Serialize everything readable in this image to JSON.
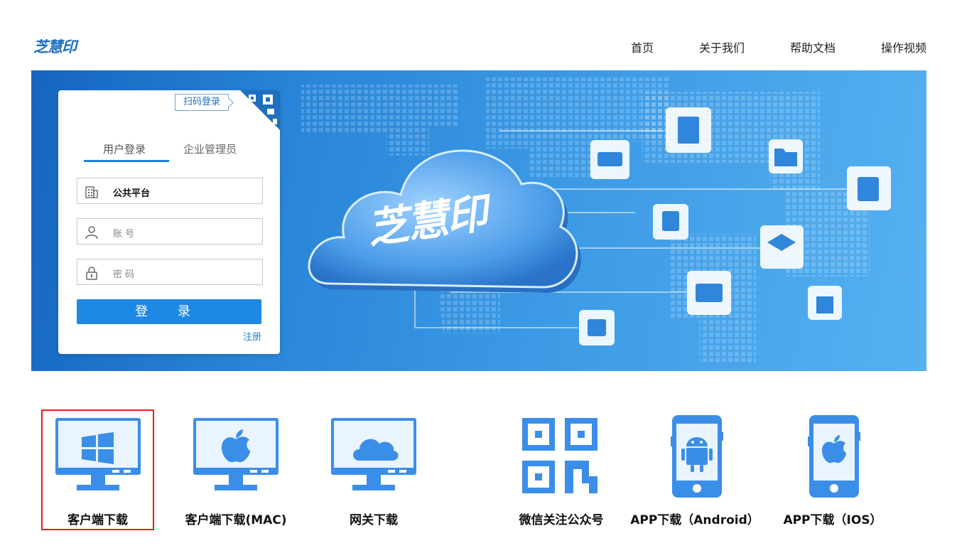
{
  "header": {
    "logo": "芝慧印",
    "nav": [
      "首页",
      "关于我们",
      "帮助文档",
      "操作视频"
    ]
  },
  "login": {
    "qr_login_label": "扫码登录",
    "tabs": [
      "用户登录",
      "企业管理员"
    ],
    "active_tab": 0,
    "platform_value": "公共平台",
    "account_placeholder": "账号",
    "password_placeholder": "密码",
    "login_button": "登 录",
    "register_link": "注册"
  },
  "banner": {
    "cloud_logo_text": "芝慧印"
  },
  "downloads": [
    {
      "label": "客户端下载",
      "icon": "windows-monitor-icon",
      "selected": true
    },
    {
      "label": "客户端下载(MAC)",
      "icon": "apple-monitor-icon",
      "selected": false
    },
    {
      "label": "网关下载",
      "icon": "cloud-monitor-icon",
      "selected": false
    },
    {
      "label": "微信关注公众号",
      "icon": "qr-code-icon",
      "selected": false
    },
    {
      "label": "APP下载（Android）",
      "icon": "android-phone-icon",
      "selected": false
    },
    {
      "label": "APP下载（IOS）",
      "icon": "ios-phone-icon",
      "selected": false
    }
  ],
  "colors": {
    "brand": "#1f6fc0",
    "button": "#1e88e5",
    "icon_blue": "#3b8ee8",
    "selection_border": "#e02020"
  }
}
